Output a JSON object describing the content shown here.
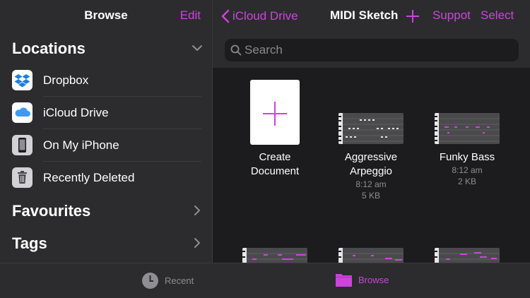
{
  "sidebar": {
    "title": "Browse",
    "edit_label": "Edit",
    "locations": {
      "heading": "Locations",
      "items": [
        {
          "label": "Dropbox",
          "icon": "dropbox-icon"
        },
        {
          "label": "iCloud Drive",
          "icon": "icloud-icon"
        },
        {
          "label": "On My iPhone",
          "icon": "iphone-icon"
        },
        {
          "label": "Recently Deleted",
          "icon": "trash-icon"
        }
      ]
    },
    "favourites": {
      "heading": "Favourites"
    },
    "tags": {
      "heading": "Tags"
    }
  },
  "nav": {
    "back_label": "iCloud Drive",
    "title": "MIDI Sketch",
    "support_label": "Suppot",
    "select_label": "Select"
  },
  "search": {
    "placeholder": "Search"
  },
  "documents": [
    {
      "name_line1": "Create",
      "name_line2": "Document"
    },
    {
      "name_line1": "Aggressive",
      "name_line2": "Arpeggio",
      "time": "8:12 am",
      "size": "5 KB"
    },
    {
      "name_line1": "Funky Bass",
      "time": "8:12 am",
      "size": "2 KB"
    }
  ],
  "tabbar": {
    "recent_label": "Recent",
    "browse_label": "Browse"
  },
  "colors": {
    "accent": "#cc44dd",
    "background": "#1c1c1e",
    "panel": "#2c2c2e"
  }
}
